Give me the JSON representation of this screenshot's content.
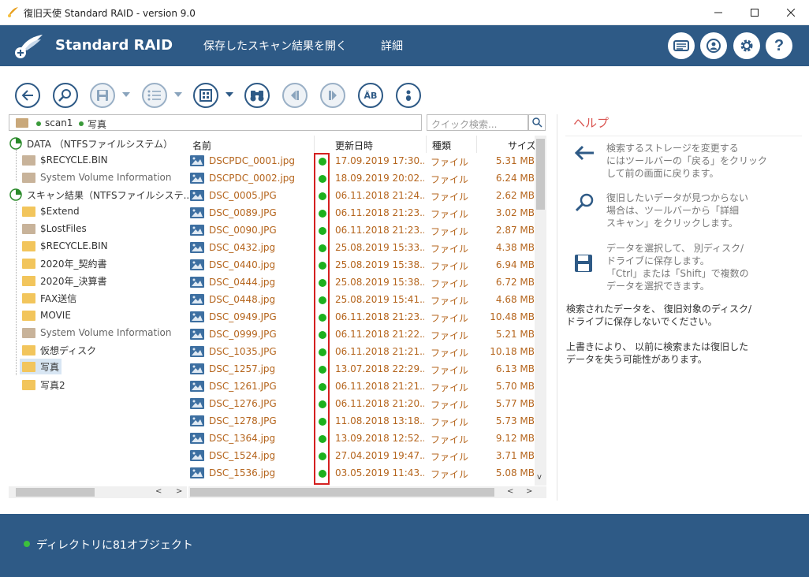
{
  "window": {
    "title": "復旧天使 Standard RAID - version 9.0",
    "controls": {
      "minimize": "—",
      "maximize": "☐",
      "close": "✕"
    }
  },
  "header": {
    "brand": "Standard RAID",
    "menu": [
      "保存したスキャン結果を開く",
      "詳細"
    ],
    "buttons": [
      "news-icon",
      "account-icon",
      "settings-icon",
      "help-icon"
    ]
  },
  "toolbar": {
    "buttons": [
      "back-icon",
      "search-detail-icon",
      "save-icon",
      "list-view-icon",
      "thumbnail-view-icon",
      "find-icon",
      "prev-icon",
      "next-icon",
      "char-encoding-icon",
      "info-icon"
    ],
    "ab_label": "ÄB"
  },
  "path": {
    "crumbs": [
      "scan1",
      "写真"
    ]
  },
  "search": {
    "placeholder": "クイック検索..."
  },
  "tree": {
    "items": [
      {
        "label": "DATA （NTFSファイルシステム）",
        "type": "root"
      },
      {
        "label": "$RECYCLE.BIN",
        "type": "grey"
      },
      {
        "label": "System Volume Information",
        "type": "grey"
      },
      {
        "label": "スキャン結果（NTFSファイルシステ..",
        "type": "root"
      },
      {
        "label": "$Extend",
        "type": "yellow"
      },
      {
        "label": "$LostFiles",
        "type": "grey"
      },
      {
        "label": "$RECYCLE.BIN",
        "type": "yellow"
      },
      {
        "label": "2020年_契約書",
        "type": "yellow"
      },
      {
        "label": "2020年_決算書",
        "type": "yellow"
      },
      {
        "label": "FAX送信",
        "type": "yellow"
      },
      {
        "label": "MOVIE",
        "type": "yellow"
      },
      {
        "label": "System Volume Information",
        "type": "grey"
      },
      {
        "label": "仮想ディスク",
        "type": "yellow"
      },
      {
        "label": "写真",
        "type": "yellow",
        "selected": true
      },
      {
        "label": "写真2",
        "type": "yellow"
      }
    ]
  },
  "list": {
    "columns": [
      "名前",
      "更新日時",
      "種類",
      "サイズ"
    ],
    "rows": [
      {
        "name": "DSCPDC_0001.jpg",
        "date": "17.09.2019 17:30...",
        "kind": "ファイル",
        "size": "5.31 MB"
      },
      {
        "name": "DSCPDC_0002.jpg",
        "date": "18.09.2019 20:02...",
        "kind": "ファイル",
        "size": "6.24 MB"
      },
      {
        "name": "DSC_0005.JPG",
        "date": "06.11.2018 21:24...",
        "kind": "ファイル",
        "size": "2.62 MB"
      },
      {
        "name": "DSC_0089.JPG",
        "date": "06.11.2018 21:23...",
        "kind": "ファイル",
        "size": "3.02 MB"
      },
      {
        "name": "DSC_0090.JPG",
        "date": "06.11.2018 21:23...",
        "kind": "ファイル",
        "size": "2.87 MB"
      },
      {
        "name": "DSC_0432.jpg",
        "date": "25.08.2019 15:33...",
        "kind": "ファイル",
        "size": "4.38 MB"
      },
      {
        "name": "DSC_0440.jpg",
        "date": "25.08.2019 15:38...",
        "kind": "ファイル",
        "size": "6.94 MB"
      },
      {
        "name": "DSC_0444.jpg",
        "date": "25.08.2019 15:38...",
        "kind": "ファイル",
        "size": "6.72 MB"
      },
      {
        "name": "DSC_0448.jpg",
        "date": "25.08.2019 15:41...",
        "kind": "ファイル",
        "size": "4.68 MB"
      },
      {
        "name": "DSC_0949.JPG",
        "date": "06.11.2018 21:23...",
        "kind": "ファイル",
        "size": "10.48 MB"
      },
      {
        "name": "DSC_0999.JPG",
        "date": "06.11.2018 21:22...",
        "kind": "ファイル",
        "size": "5.21 MB"
      },
      {
        "name": "DSC_1035.JPG",
        "date": "06.11.2018 21:21...",
        "kind": "ファイル",
        "size": "10.18 MB"
      },
      {
        "name": "DSC_1257.jpg",
        "date": "13.07.2018 22:29...",
        "kind": "ファイル",
        "size": "6.13 MB"
      },
      {
        "name": "DSC_1261.JPG",
        "date": "06.11.2018 21:21...",
        "kind": "ファイル",
        "size": "5.70 MB"
      },
      {
        "name": "DSC_1276.JPG",
        "date": "06.11.2018 21:20...",
        "kind": "ファイル",
        "size": "5.77 MB"
      },
      {
        "name": "DSC_1278.JPG",
        "date": "11.08.2018 13:18...",
        "kind": "ファイル",
        "size": "5.73 MB"
      },
      {
        "name": "DSC_1364.jpg",
        "date": "13.09.2018 12:52...",
        "kind": "ファイル",
        "size": "9.12 MB"
      },
      {
        "name": "DSC_1524.jpg",
        "date": "27.04.2019 19:47...",
        "kind": "ファイル",
        "size": "3.71 MB"
      },
      {
        "name": "DSC_1536.jpg",
        "date": "03.05.2019 11:43...",
        "kind": "ファイル",
        "size": "5.08 MB"
      }
    ]
  },
  "help": {
    "title": "ヘルプ",
    "items": [
      {
        "icon": "back-arrow-icon",
        "text": "検索するストレージを変更する\nにはツールバーの「戻る」をクリック\nして前の画面に戻ります。"
      },
      {
        "icon": "detail-scan-icon",
        "text": "復旧したいデータが見つからない\n場合は、ツールバーから「詳細\nスキャン」をクリックします。"
      },
      {
        "icon": "floppy-save-icon",
        "text": "データを選択して、 別ディスク/\nドライブに保存します。\n「Ctrl」または「Shift」で複数の\nデータを選択できます。"
      }
    ],
    "warnings": [
      "検索されたデータを、 復旧対象のディスク/\nドライブに保存しないでください。",
      "上書きにより、 以前に検索または復旧した\nデータを失う可能性があります。"
    ]
  },
  "status": {
    "text": "ディレクトリに81オブジェクト"
  },
  "colors": {
    "accent": "#2e5a86",
    "file_text": "#b5651d",
    "ok": "#1db01d",
    "highlight": "#d42020"
  }
}
